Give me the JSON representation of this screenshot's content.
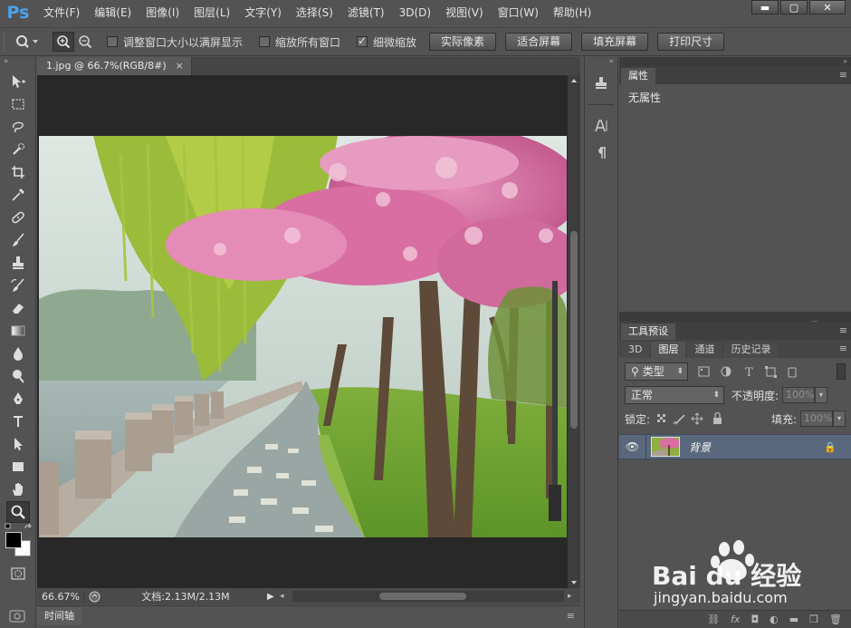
{
  "app": {
    "logo": "Ps"
  },
  "menu": [
    "文件(F)",
    "编辑(E)",
    "图像(I)",
    "图层(L)",
    "文字(Y)",
    "选择(S)",
    "滤镜(T)",
    "3D(D)",
    "视图(V)",
    "窗口(W)",
    "帮助(H)"
  ],
  "window_controls": {
    "minimize": "▬",
    "maximize": "▢",
    "close": "✕"
  },
  "options": {
    "resize_windows": "调整窗口大小以满屏显示",
    "zoom_all": "缩放所有窗口",
    "scrubby_zoom": "细微缩放",
    "actual_pixels": "实际像素",
    "fit_screen": "适合屏幕",
    "fill_screen": "填充屏幕",
    "print_size": "打印尺寸"
  },
  "document": {
    "tab_title": "1.jpg @ 66.7%(RGB/8#)",
    "tab_close": "×",
    "zoom_level": "66.67%",
    "doc_size": "文档:2.13M/2.13M"
  },
  "timeline": {
    "tab": "时间轴"
  },
  "properties": {
    "tab": "属性",
    "body": "无属性"
  },
  "tool_presets": {
    "tab": "工具预设"
  },
  "layers": {
    "tabs": [
      "3D",
      "图层",
      "通道",
      "历史记录"
    ],
    "filter_kind": "类型",
    "blend_mode": "正常",
    "opacity_label": "不透明度:",
    "opacity_value": "100%",
    "lock_label": "锁定:",
    "fill_label": "填充:",
    "fill_value": "100%",
    "items": [
      {
        "name": "背景",
        "visible": true,
        "locked": true
      }
    ]
  },
  "watermark": {
    "brand": "Bai du 经验",
    "url": "jingyan.baidu.com"
  },
  "colors": {
    "accent": "#4aa3f0",
    "layer_selected": "#59687c",
    "ui_bg": "#535353",
    "canvas_bg": "#282828"
  }
}
